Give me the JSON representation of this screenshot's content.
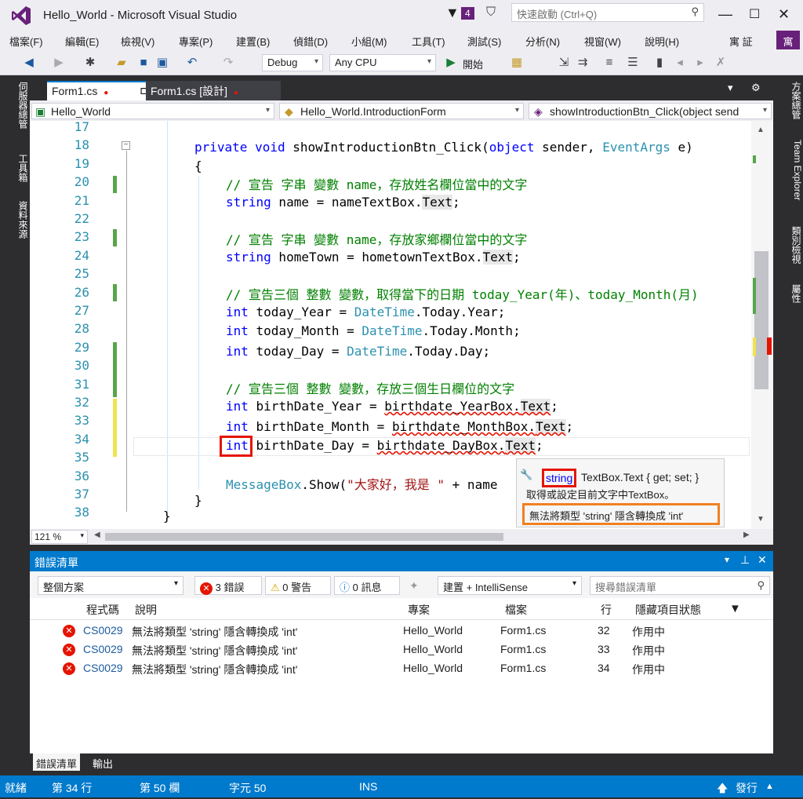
{
  "window": {
    "title": "Hello_World - Microsoft Visual Studio",
    "notif_count": "4",
    "quick_launch_placeholder": "快速啟動 (Ctrl+Q)",
    "user": "寓 証",
    "avatar": "寓"
  },
  "menu": [
    "檔案(F)",
    "編輯(E)",
    "檢視(V)",
    "專案(P)",
    "建置(B)",
    "偵錯(D)",
    "小組(M)",
    "工具(T)",
    "測試(S)",
    "分析(N)",
    "視窗(W)",
    "說明(H)"
  ],
  "toolbar": {
    "config": "Debug",
    "platform": "Any CPU",
    "start": "開始"
  },
  "left_tabs": [
    "伺服器總管",
    "工具箱",
    "資料來源"
  ],
  "right_tabs": [
    "方案總管",
    "Team Explorer",
    "類別檢視",
    "屬性"
  ],
  "doc_tabs": [
    {
      "label": "Form1.cs",
      "active": true
    },
    {
      "label": "Form1.cs [設計]",
      "active": false
    }
  ],
  "nav": {
    "project": "Hello_World",
    "class": "Hello_World.IntroductionForm",
    "member": "showIntroductionBtn_Click(object send"
  },
  "line_numbers": [
    "17",
    "18",
    "19",
    "20",
    "21",
    "22",
    "23",
    "24",
    "25",
    "26",
    "27",
    "28",
    "29",
    "30",
    "31",
    "32",
    "33",
    "34",
    "35",
    "36",
    "37",
    "38"
  ],
  "tooltip": {
    "type": "string",
    "sig_rest": "TextBox.Text { get; set; }",
    "desc": "取得或設定目前文字中TextBox。",
    "error": "無法將類型 'string' 隱含轉換成 'int'"
  },
  "editor_bottom": {
    "zoom": "121 %"
  },
  "error_list": {
    "title": "錯誤清單",
    "scope": "整個方案",
    "errors_btn": "3 錯誤",
    "warnings_btn": "0 警告",
    "messages_btn": "0 訊息",
    "build_filter": "建置 + IntelliSense",
    "search_placeholder": "搜尋錯誤清單",
    "headers": [
      "程式碼",
      "說明",
      "專案",
      "檔案",
      "行",
      "隱藏項目狀態"
    ],
    "rows": [
      {
        "code": "CS0029",
        "desc": "無法將類型 'string' 隱含轉換成 'int'",
        "project": "Hello_World",
        "file": "Form1.cs",
        "line": "32",
        "state": "作用中"
      },
      {
        "code": "CS0029",
        "desc": "無法將類型 'string' 隱含轉換成 'int'",
        "project": "Hello_World",
        "file": "Form1.cs",
        "line": "33",
        "state": "作用中"
      },
      {
        "code": "CS0029",
        "desc": "無法將類型 'string' 隱含轉換成 'int'",
        "project": "Hello_World",
        "file": "Form1.cs",
        "line": "34",
        "state": "作用中"
      }
    ],
    "bottom_tabs": [
      "錯誤清單",
      "輸出"
    ]
  },
  "status": {
    "ready": "就緒",
    "line": "第 34 行",
    "col": "第 50 欄",
    "char": "字元 50",
    "ins": "INS",
    "publish": "發行"
  },
  "colors": {
    "accent": "#007acc",
    "vs_purple": "#68217a",
    "error_red": "#e51400",
    "highlight_red": "#e51400",
    "highlight_orange": "#f08020"
  }
}
